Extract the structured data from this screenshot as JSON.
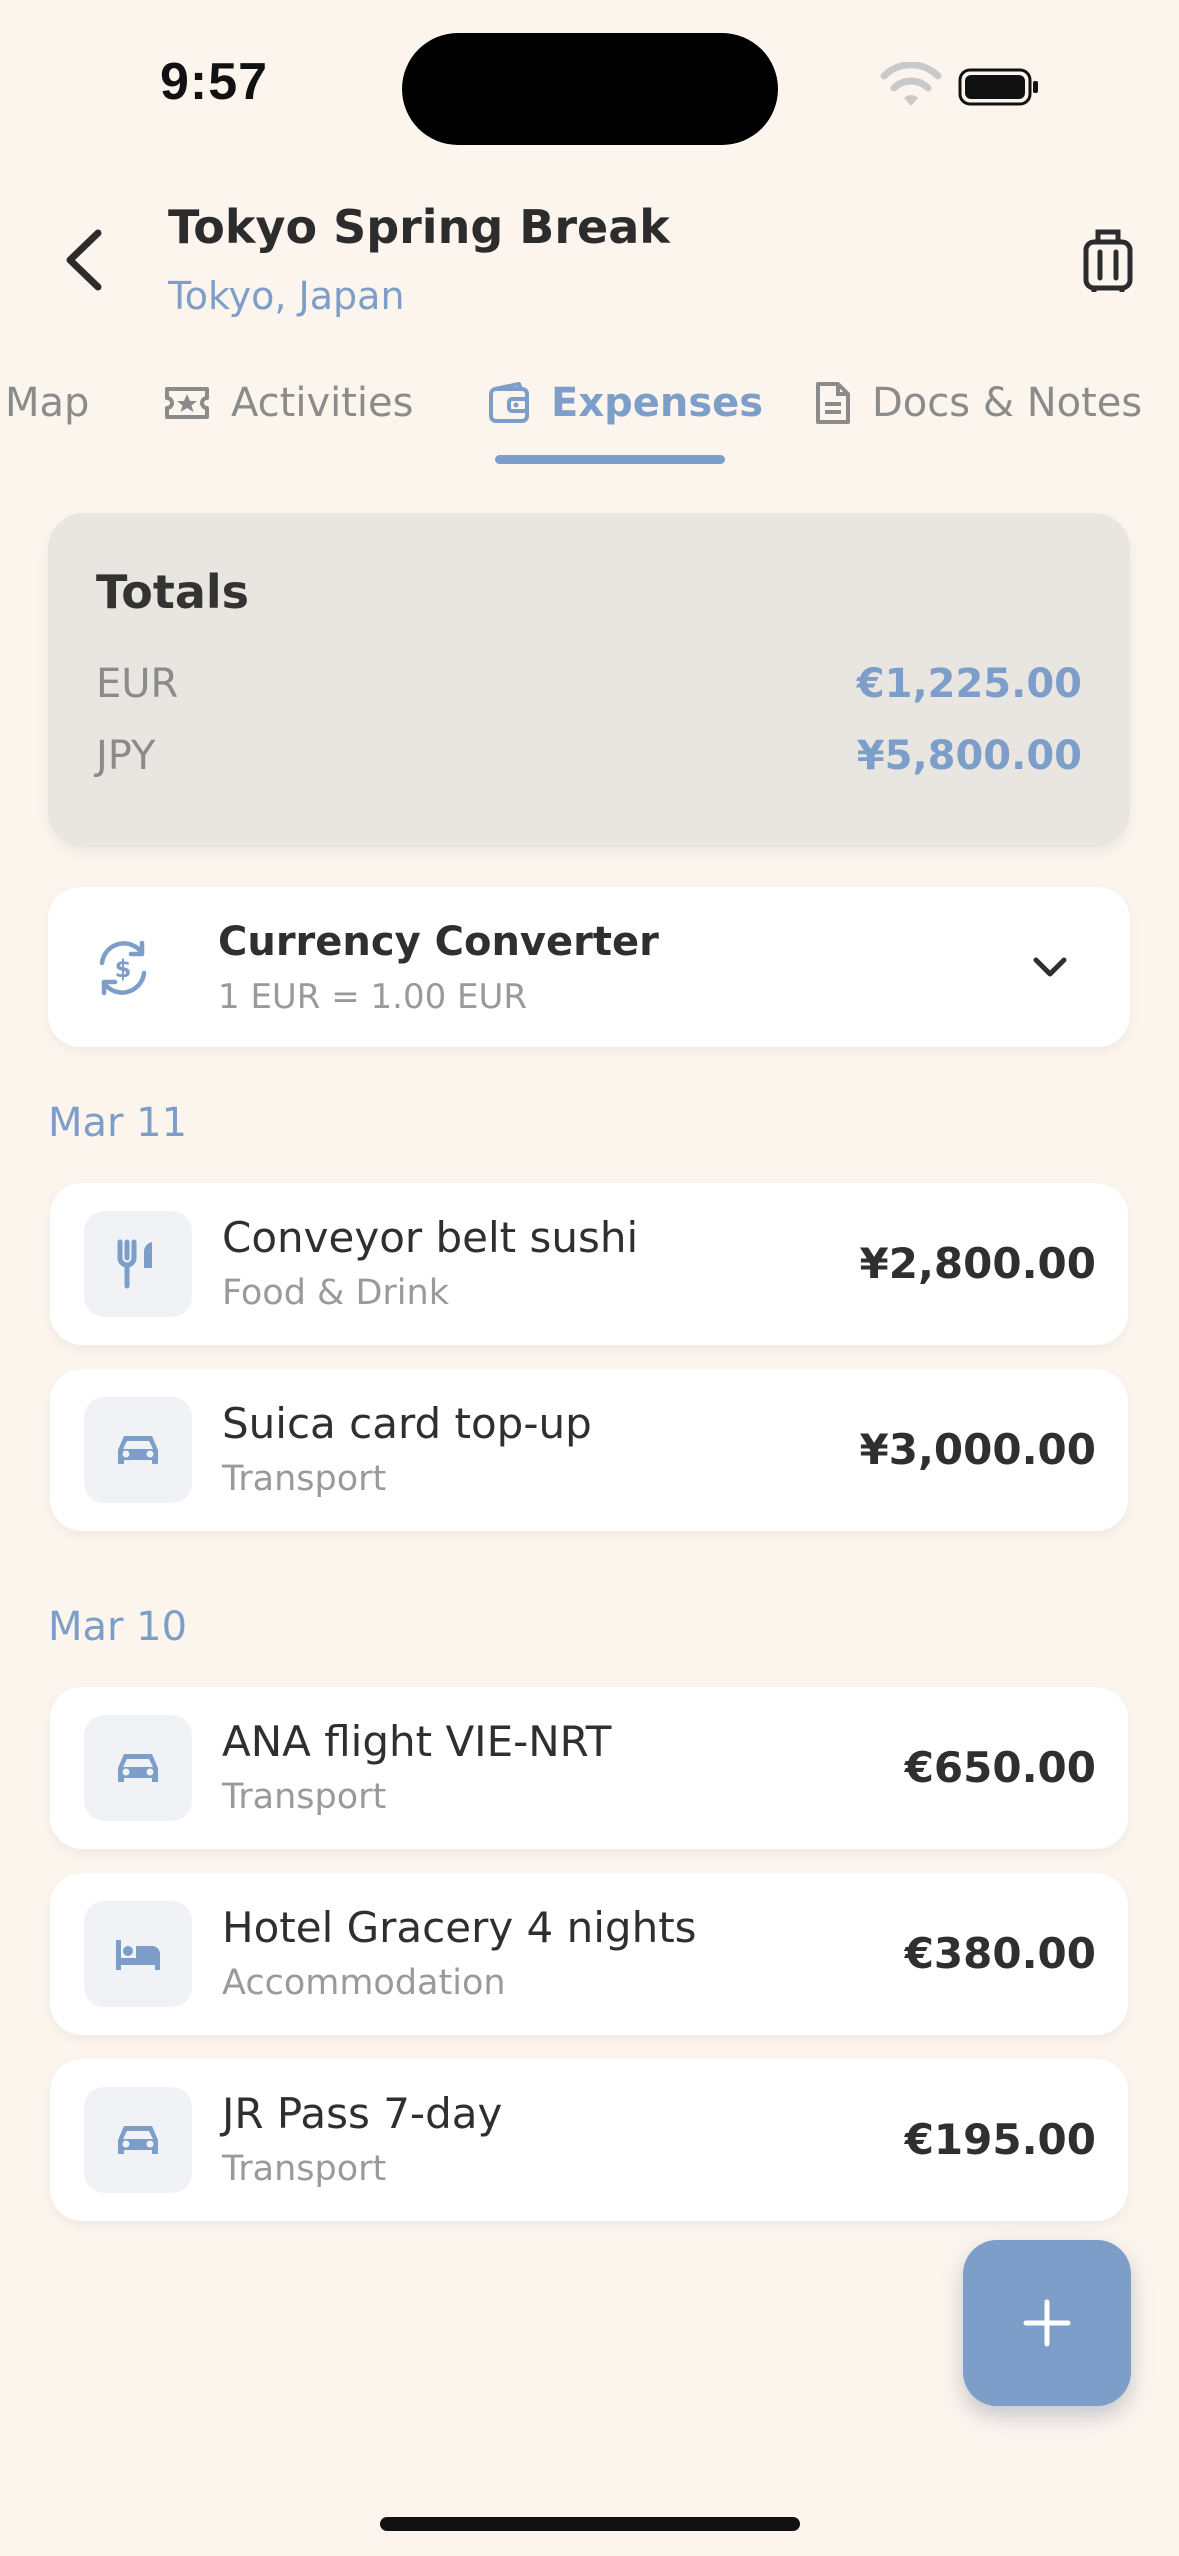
{
  "status": {
    "time": "9:57"
  },
  "header": {
    "title": "Tokyo Spring Break",
    "subtitle": "Tokyo, Japan"
  },
  "tabs": [
    {
      "label": "Map",
      "icon": "map-icon"
    },
    {
      "label": "Activities",
      "icon": "ticket-icon"
    },
    {
      "label": "Expenses",
      "icon": "wallet-icon",
      "active": true
    },
    {
      "label": "Docs & Notes",
      "icon": "document-icon"
    }
  ],
  "totals": {
    "title": "Totals",
    "rows": [
      {
        "currency": "EUR",
        "value": "€1,225.00"
      },
      {
        "currency": "JPY",
        "value": "¥5,800.00"
      }
    ]
  },
  "converter": {
    "title": "Currency Converter",
    "rate": "1 EUR = 1.00 EUR"
  },
  "groups": [
    {
      "date": "Mar 11",
      "items": [
        {
          "name": "Conveyor belt sushi",
          "category": "Food & Drink",
          "amount": "¥2,800.00",
          "icon": "fork-knife-icon"
        },
        {
          "name": "Suica card top-up",
          "category": "Transport",
          "amount": "¥3,000.00",
          "icon": "car-icon"
        }
      ]
    },
    {
      "date": "Mar 10",
      "items": [
        {
          "name": "ANA flight VIE-NRT",
          "category": "Transport",
          "amount": "€650.00",
          "icon": "car-icon"
        },
        {
          "name": "Hotel Gracery 4 nights",
          "category": "Accommodation",
          "amount": "€380.00",
          "icon": "bed-icon"
        },
        {
          "name": "JR Pass 7-day",
          "category": "Transport",
          "amount": "€195.00",
          "icon": "car-icon"
        }
      ]
    }
  ],
  "colors": {
    "accent": "#7c9ec8",
    "background": "#fcf5ee",
    "card": "#ffffff",
    "totals_card": "#e9e6e2"
  }
}
